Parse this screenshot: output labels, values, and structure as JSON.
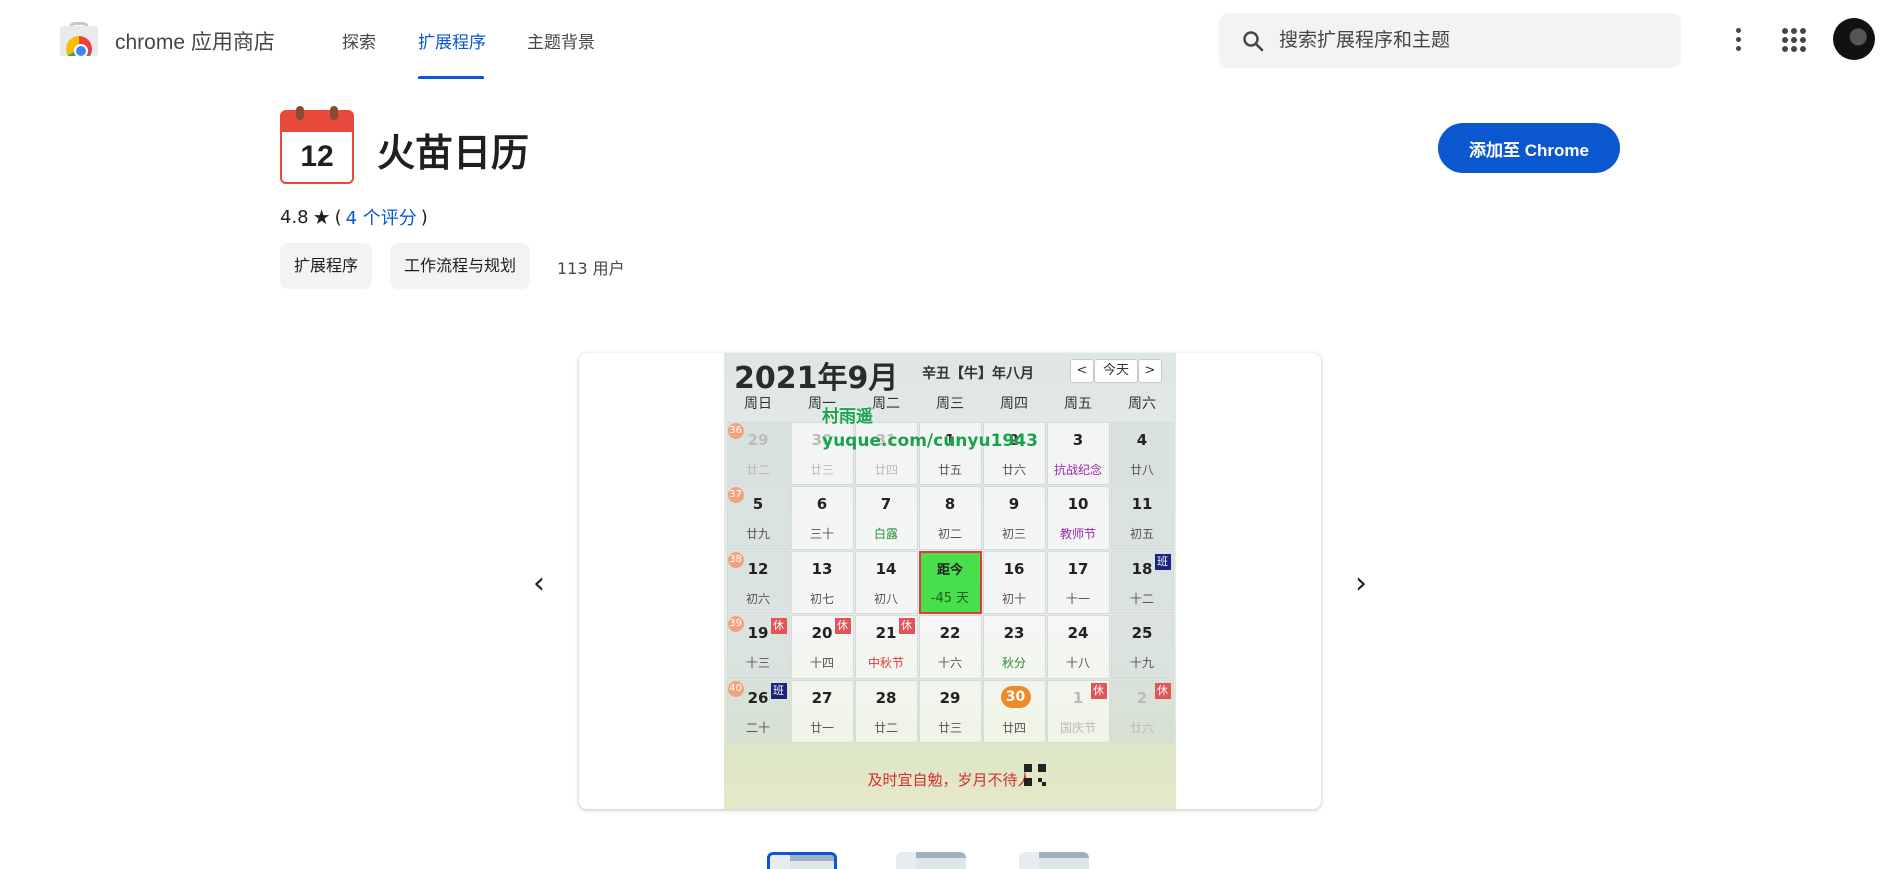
{
  "header": {
    "store_name": "chrome 应用商店",
    "tabs": [
      {
        "label": "探索",
        "active": false
      },
      {
        "label": "扩展程序",
        "active": true
      },
      {
        "label": "主题背景",
        "active": false
      }
    ],
    "search_placeholder": "搜索扩展程序和主题",
    "accent_color": "#0b57d0"
  },
  "extension": {
    "icon_number": "12",
    "title": "火苗日历",
    "add_button": "添加至 Chrome",
    "rating": "4.8",
    "rating_count_link": "4 个评分",
    "chips": [
      "扩展程序",
      "工作流程与规划"
    ],
    "users": "113 用户"
  },
  "carousel": {
    "prev_icon": "‹",
    "next_icon": "›",
    "calendar": {
      "title": "2021年9月",
      "lunar": "辛丑【牛】年八月",
      "nav_prev": "<",
      "nav_today": "今天",
      "nav_next": ">",
      "weekdays": [
        "周日",
        "周一",
        "周二",
        "周三",
        "周四",
        "周五",
        "周六"
      ],
      "watermark_line1": "村雨遥",
      "watermark_line2": "yuque.com/cunyu1943",
      "motto": "及时宜自勉，岁月不待人",
      "weeks": [
        {
          "week": "36",
          "days": [
            {
              "d": "29",
              "l": "廿二",
              "faded": true
            },
            {
              "d": "30",
              "l": "廿三",
              "faded": true
            },
            {
              "d": "31",
              "l": "廿四",
              "faded": true
            },
            {
              "d": "1",
              "l": "廿五"
            },
            {
              "d": "2",
              "l": "廿六"
            },
            {
              "d": "3",
              "l": "抗战纪念",
              "lc": "purple"
            },
            {
              "d": "4",
              "l": "廿八"
            }
          ]
        },
        {
          "week": "37",
          "days": [
            {
              "d": "5",
              "l": "廿九"
            },
            {
              "d": "6",
              "l": "三十"
            },
            {
              "d": "7",
              "l": "白露",
              "lc": "green"
            },
            {
              "d": "8",
              "l": "初二"
            },
            {
              "d": "9",
              "l": "初三"
            },
            {
              "d": "10",
              "l": "教师节",
              "lc": "purple"
            },
            {
              "d": "11",
              "l": "初五"
            }
          ]
        },
        {
          "week": "38",
          "days": [
            {
              "d": "12",
              "l": "初六"
            },
            {
              "d": "13",
              "l": "初七"
            },
            {
              "d": "14",
              "l": "初八"
            },
            {
              "d": "距今",
              "l": "-45 天",
              "today": true
            },
            {
              "d": "16",
              "l": "初十"
            },
            {
              "d": "17",
              "l": "十一"
            },
            {
              "d": "18",
              "l": "十二",
              "tag": "班",
              "tagtype": "work"
            }
          ]
        },
        {
          "week": "39",
          "days": [
            {
              "d": "19",
              "l": "十三",
              "tag": "休",
              "tagtype": "rest"
            },
            {
              "d": "20",
              "l": "十四",
              "tag": "休",
              "tagtype": "rest"
            },
            {
              "d": "21",
              "l": "中秋节",
              "lc": "red",
              "tag": "休",
              "tagtype": "rest"
            },
            {
              "d": "22",
              "l": "十六"
            },
            {
              "d": "23",
              "l": "秋分",
              "lc": "green"
            },
            {
              "d": "24",
              "l": "十八"
            },
            {
              "d": "25",
              "l": "十九"
            }
          ]
        },
        {
          "week": "40",
          "days": [
            {
              "d": "26",
              "l": "二十",
              "tag": "班",
              "tagtype": "work"
            },
            {
              "d": "27",
              "l": "廿一"
            },
            {
              "d": "28",
              "l": "廿二"
            },
            {
              "d": "29",
              "l": "廿三"
            },
            {
              "d": "30",
              "l": "廿四",
              "circle": true
            },
            {
              "d": "1",
              "l": "国庆节",
              "faded": true,
              "tag": "休",
              "tagtype": "rest"
            },
            {
              "d": "2",
              "l": "廿六",
              "faded": true,
              "tag": "休",
              "tagtype": "rest"
            }
          ]
        }
      ]
    }
  }
}
